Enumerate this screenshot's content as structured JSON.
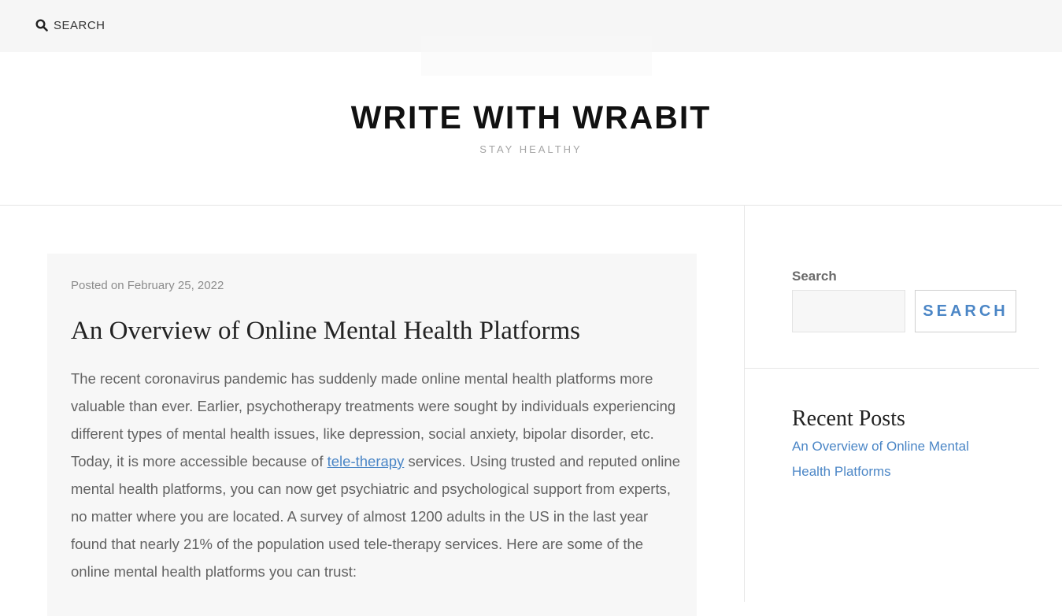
{
  "topbar": {
    "search_label": "SEARCH",
    "search_icon": "search-icon"
  },
  "branding": {
    "title": "WRITE WITH WRABIT",
    "tagline": "STAY HEALTHY"
  },
  "post": {
    "meta": "Posted on February 25, 2022",
    "title": "An Overview of Online Mental Health Platforms",
    "body_part1": "The recent coronavirus pandemic has suddenly made online mental health platforms more valuable than ever. Earlier, psychotherapy treatments were sought by individuals experiencing different types of mental health issues, like depression, social anxiety, bipolar disorder, etc. Today, it is more accessible because of ",
    "body_link": "tele-therapy",
    "body_part2": " services. Using trusted and reputed online mental health platforms, you can now get psychiatric and psychological support from experts, no matter where you are located. A survey of almost 1200 adults in the US in the last year found that nearly 21% of the population used tele-therapy services. Here are some of the online mental health platforms you can trust:"
  },
  "sidebar": {
    "search_widget": {
      "label": "Search",
      "input_value": "",
      "button_label": "SEARCH"
    },
    "recent_posts": {
      "title": "Recent Posts",
      "items": [
        {
          "label": "An Overview of Online Mental Health Platforms"
        }
      ]
    }
  },
  "colors": {
    "accent": "#4b86c6",
    "topbar_bg": "#f6f6f6",
    "card_bg": "#f7f7f7"
  }
}
